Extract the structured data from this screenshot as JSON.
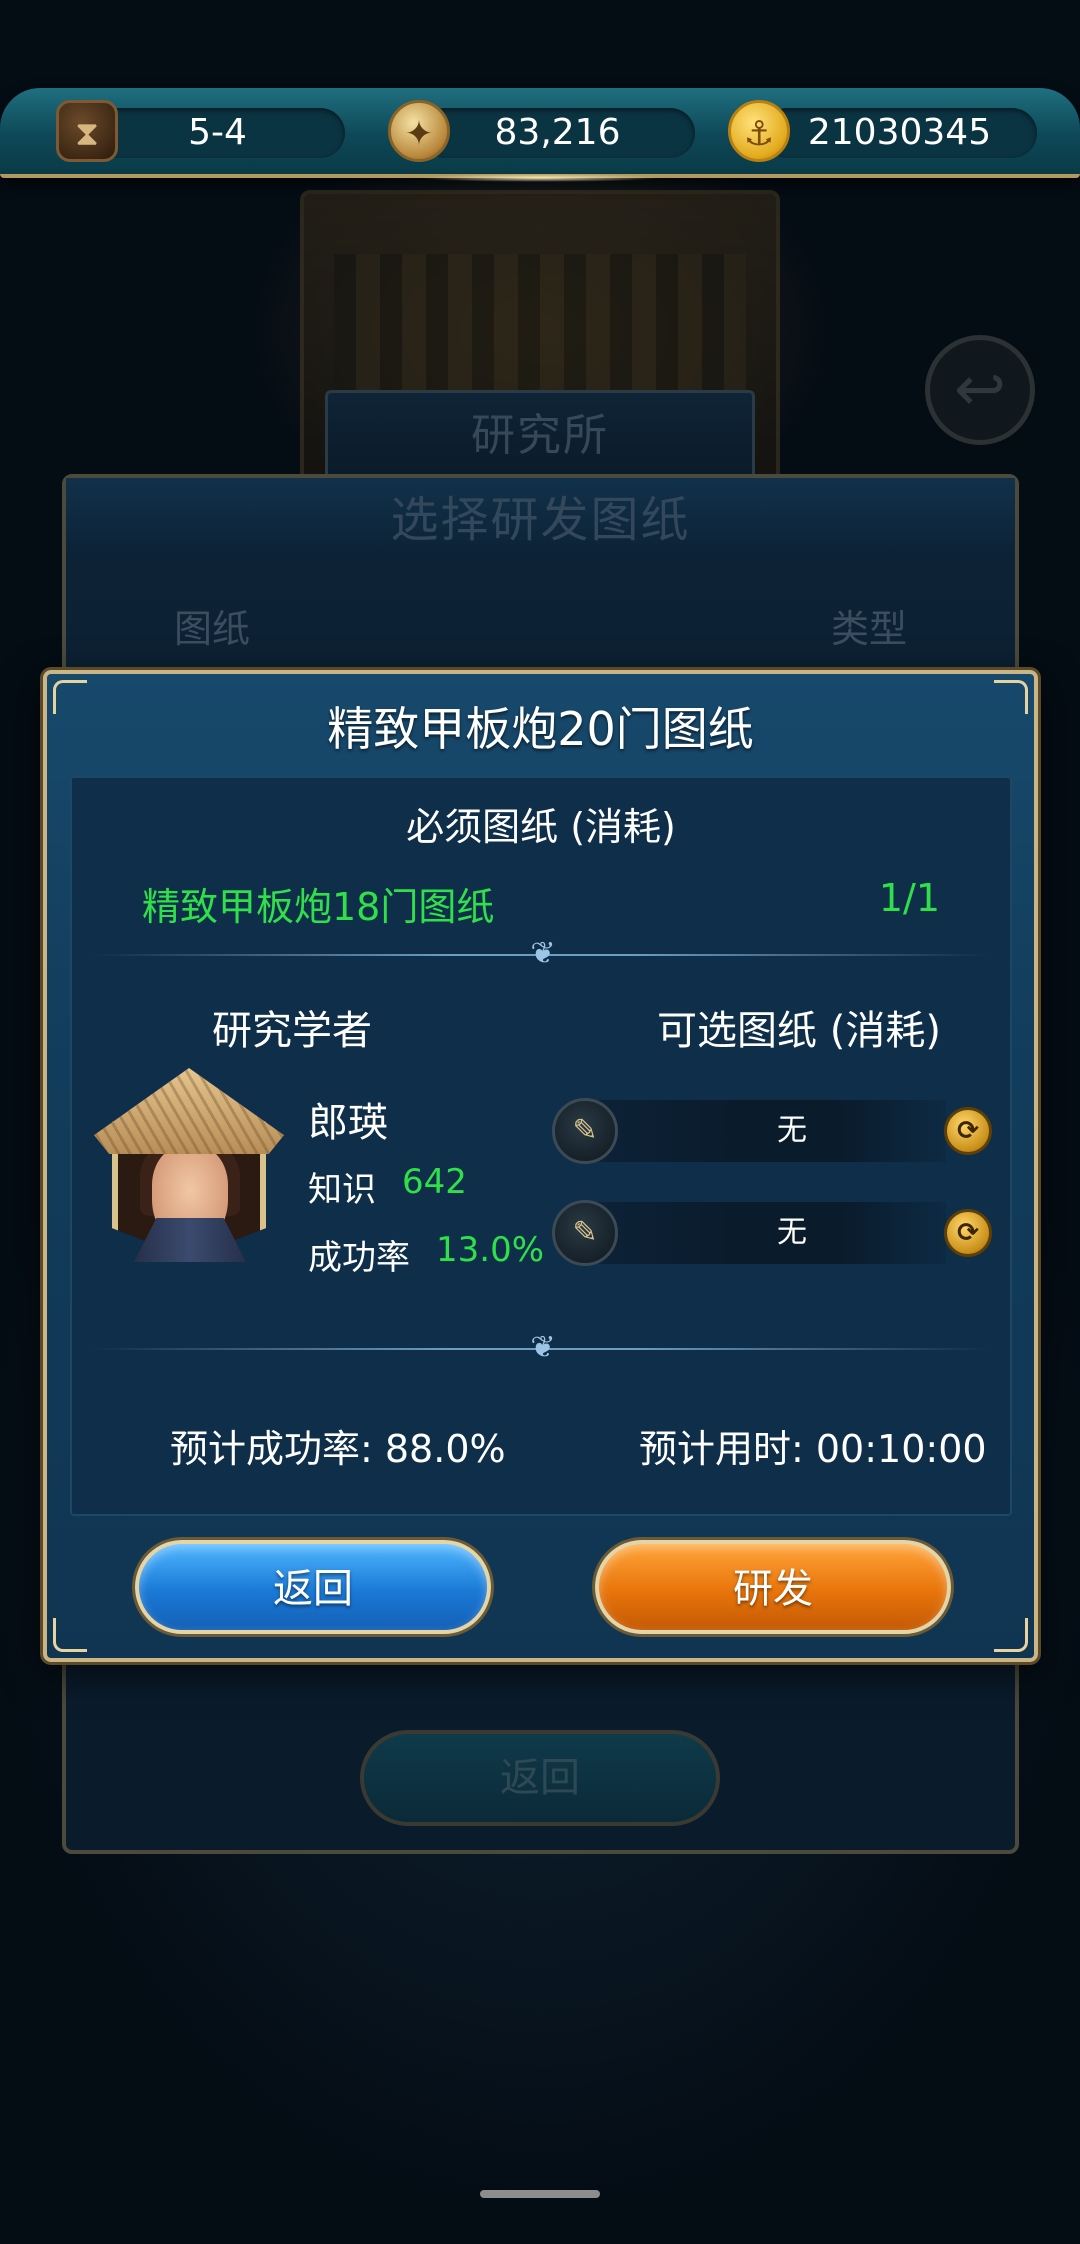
{
  "topbar": {
    "stage": "5-4",
    "compass_value": "83,216",
    "gold_value": "21030345",
    "icons": [
      "hourglass-icon",
      "compass-icon",
      "anchor-coin-icon"
    ]
  },
  "background": {
    "institute_label": "研究所",
    "panel_title": "选择研发图纸",
    "col_blueprint": "图纸",
    "col_type": "类型",
    "return_label": "返回"
  },
  "dialog": {
    "title": "精致甲板炮20门图纸",
    "required_heading": "必须图纸 (消耗)",
    "required_item": "精致甲板炮18门图纸",
    "required_count": "1/1",
    "scholar_heading": "研究学者",
    "optional_heading": "可选图纸 (消耗)",
    "scholar_name": "郎瑛",
    "knowledge_label": "知识",
    "knowledge_value": "642",
    "success_label": "成功率",
    "success_value": "13.0%",
    "slots": [
      {
        "label": "无"
      },
      {
        "label": "无"
      }
    ],
    "estimated_success": "预计成功率: 88.0%",
    "estimated_time": "预计用时: 00:10:00",
    "back_button": "返回",
    "develop_button": "研发"
  },
  "colors": {
    "highlight_green": "#2fe04a",
    "dialog_border": "#cbb584",
    "back_button": "#1a79d6",
    "develop_button": "#e8750b"
  }
}
